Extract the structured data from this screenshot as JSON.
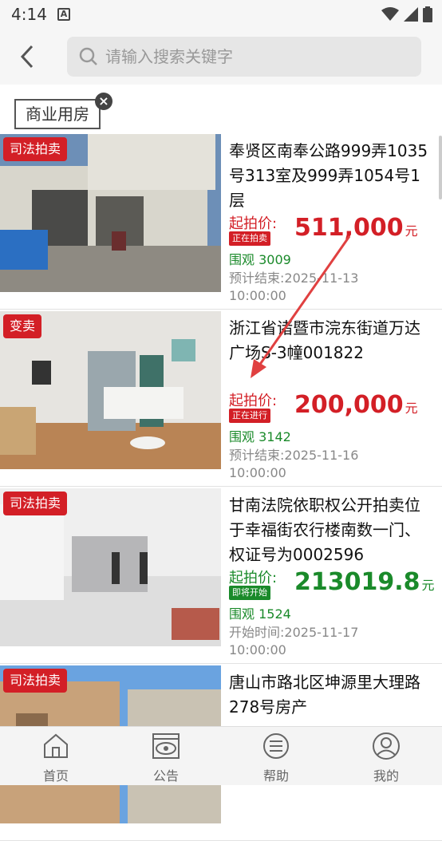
{
  "status_bar": {
    "time": "4:14",
    "a_icon": "A"
  },
  "search": {
    "placeholder": "请输入搜索关键字"
  },
  "filter_tag": {
    "label": "商业用房"
  },
  "listings": [
    {
      "badge": "司法拍卖",
      "title": "奉贤区南奉公路999弄1035号313室及999弄1054号1层",
      "price_label": "起拍价:",
      "status": "正在拍卖",
      "status_color": "#d31f26",
      "price": "511,000",
      "unit": "元",
      "price_color": "#d31f26",
      "views": "围观 3009",
      "time_label": "预计结束:",
      "time_value": "2025-11-13 10:00:00"
    },
    {
      "badge": "变卖",
      "title": "浙江省诸暨市浣东街道万达广场S-3幢001822",
      "price_label": "起拍价:",
      "status": "正在进行",
      "status_color": "#d31f26",
      "price": "200,000",
      "unit": "元",
      "price_color": "#d31f26",
      "views": "围观 3142",
      "time_label": "预计结束:",
      "time_value": "2025-11-16 10:00:00"
    },
    {
      "badge": "司法拍卖",
      "title": "甘南法院依职权公开拍卖位于幸福街农行楼南数一门、权证号为0002596",
      "price_label": "起拍价:",
      "status": "即将开始",
      "status_color": "#1a8a2a",
      "price": "213019.8",
      "unit": "元",
      "price_color": "#1a8a2a",
      "views": "围观 1524",
      "time_label": "开始时间:",
      "time_value": "2025-11-17 10:00:00"
    },
    {
      "badge": "司法拍卖",
      "title": "唐山市路北区坤源里大理路278号房产"
    }
  ],
  "tabbar": [
    {
      "label": "首页",
      "icon": "home-icon"
    },
    {
      "label": "公告",
      "icon": "eye-icon"
    },
    {
      "label": "帮助",
      "icon": "menu-circle-icon"
    },
    {
      "label": "我的",
      "icon": "user-icon"
    }
  ],
  "colors": {
    "accent": "#d31f26",
    "green": "#1a8a2a"
  }
}
